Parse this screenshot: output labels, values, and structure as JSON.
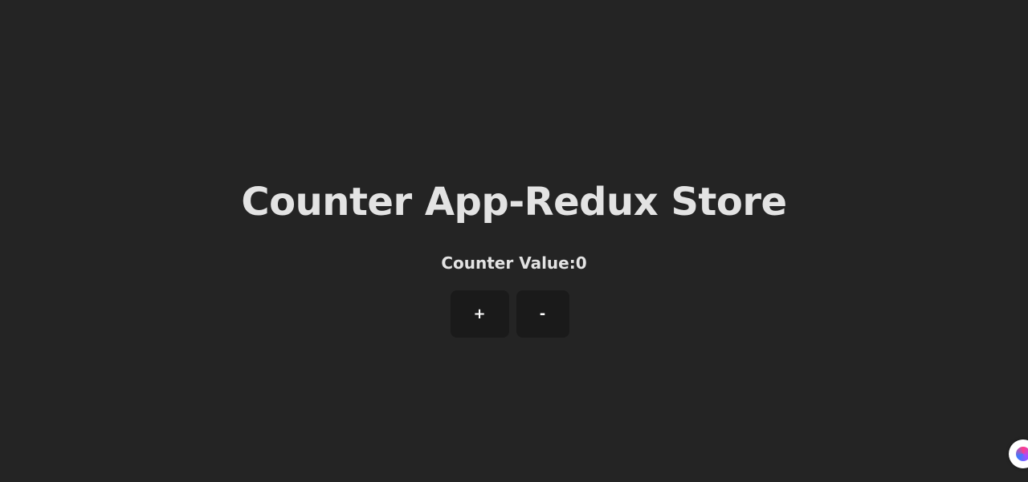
{
  "app": {
    "title": "Counter App-Redux Store",
    "counter_text": "Counter Value:0"
  },
  "controls": {
    "increment_label": "+",
    "decrement_label": "-"
  },
  "widget": {
    "icon": "extension-logo-icon"
  }
}
